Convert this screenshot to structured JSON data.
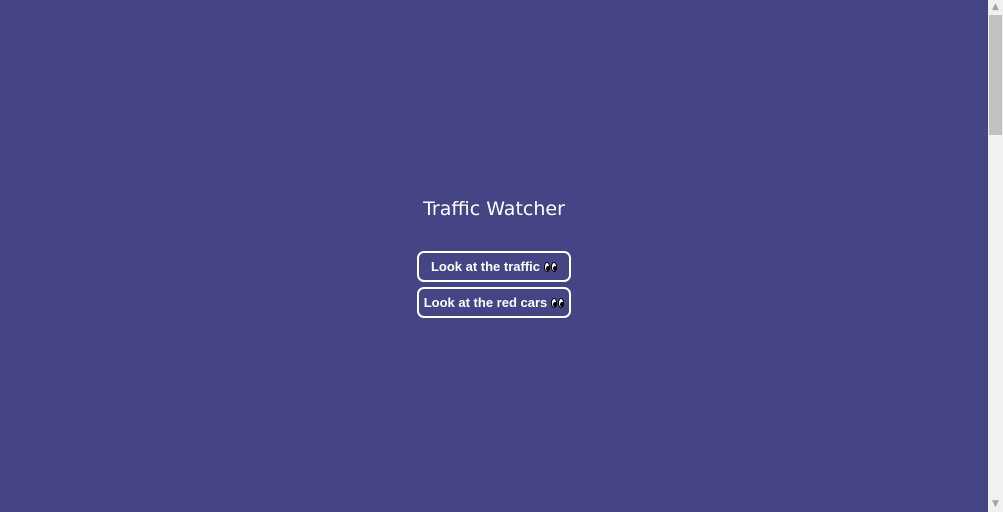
{
  "page": {
    "title": "Traffic Watcher",
    "background_color": "#454586"
  },
  "buttons": [
    {
      "label": "Look at the traffic",
      "icon": "eyes-icon"
    },
    {
      "label": "Look at the red cars",
      "icon": "eyes-icon"
    }
  ],
  "scrollbar": {
    "up_arrow": "▲",
    "down_arrow": "▼"
  }
}
